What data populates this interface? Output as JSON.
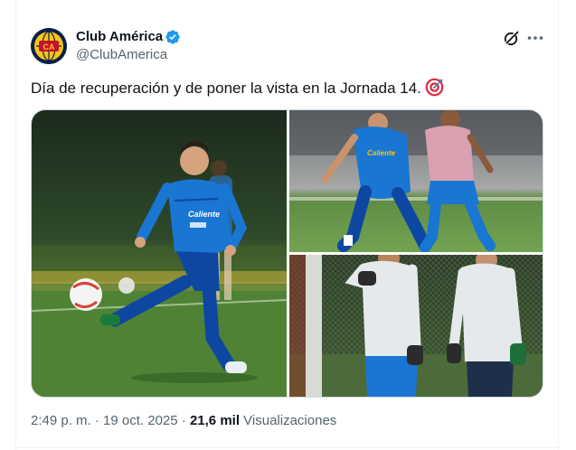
{
  "author": {
    "display_name": "Club América",
    "handle": "@ClubAmerica",
    "avatar_text": "CA",
    "verified": true
  },
  "tweet": {
    "text": "Día de recuperación y de poner la vista en la Jornada 14.",
    "emoji": "target-emoji"
  },
  "media": {
    "count": 3,
    "photos": [
      {
        "icon": "player-kicking-ball-photo"
      },
      {
        "icon": "players-training-photo"
      },
      {
        "icon": "goalkeepers-photo"
      }
    ],
    "shirt_text": "Caliente"
  },
  "meta": {
    "time": "2:49 p. m. · 19 oct. 2025",
    "separator": " · ",
    "views_count": "21,6 mil",
    "views_label": "Visualizaciones"
  },
  "colors": {
    "verified_blue": "#1d9bf0",
    "secondary_text": "#536471",
    "club_blue": "#0d47a1",
    "club_yellow": "#f5c518"
  }
}
